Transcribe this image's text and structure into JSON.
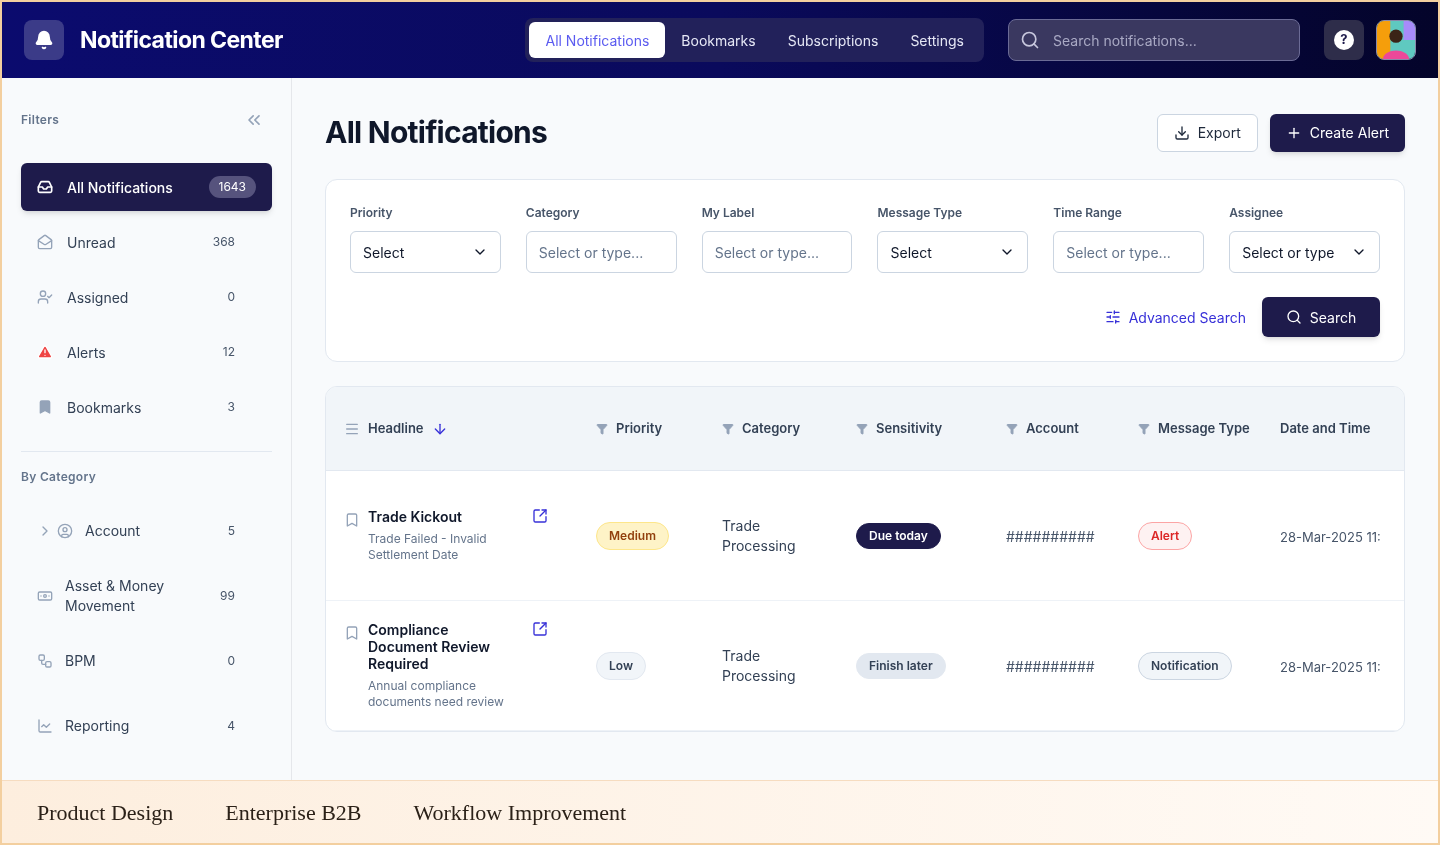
{
  "header": {
    "title": "Notification Center",
    "tabs": [
      {
        "label": "All Notifications",
        "selected": true
      },
      {
        "label": "Bookmarks",
        "selected": false
      },
      {
        "label": "Subscriptions",
        "selected": false
      },
      {
        "label": "Settings",
        "selected": false
      }
    ],
    "search": {
      "placeholder": "Search notifications..."
    },
    "help": "?"
  },
  "sidebar": {
    "title": "Filters",
    "items": [
      {
        "label": "All Notifications",
        "count": "1643",
        "selected": true
      },
      {
        "label": "Unread",
        "count": "368",
        "selected": false
      },
      {
        "label": "Assigned",
        "count": "0",
        "selected": false
      },
      {
        "label": "Alerts",
        "count": "12",
        "selected": false
      },
      {
        "label": "Bookmarks",
        "count": "3",
        "selected": false
      }
    ],
    "category_title": "By Category",
    "categories": [
      {
        "label": "Account",
        "count": "5",
        "expanded": false
      },
      {
        "label": "Asset & Money Movement",
        "count": "99"
      },
      {
        "label": "BPM",
        "count": "0"
      },
      {
        "label": "Reporting",
        "count": "4"
      }
    ]
  },
  "main": {
    "title": "All Notifications",
    "export": "Export",
    "create": "Create Alert",
    "filters": [
      {
        "label": "Priority",
        "kind": "select",
        "value": "Select"
      },
      {
        "label": "Category",
        "kind": "input",
        "placeholder": "Select or type..."
      },
      {
        "label": "My Label",
        "kind": "input",
        "placeholder": "Select or type..."
      },
      {
        "label": "Message Type",
        "kind": "select",
        "value": "Select"
      },
      {
        "label": "Time Range",
        "kind": "input",
        "placeholder": "Select or type..."
      },
      {
        "label": "Assignee",
        "kind": "select",
        "value": "Select or type"
      }
    ],
    "advanced": "Advanced Search",
    "search": "Search",
    "table": {
      "columns": [
        {
          "label": "Headline",
          "kind": "sort"
        },
        {
          "label": "Priority",
          "kind": "filter"
        },
        {
          "label": "Category",
          "kind": "filter"
        },
        {
          "label": "Sensitivity",
          "kind": "filter"
        },
        {
          "label": "Account",
          "kind": "filter"
        },
        {
          "label": "Message Type",
          "kind": "filter"
        },
        {
          "label": "Date and Time",
          "kind": "plain"
        }
      ],
      "rows": [
        {
          "headline": "Trade Kickout",
          "detail": "Trade Failed - Invalid Settlement Date",
          "priority": {
            "label": "Medium",
            "kind": "medium"
          },
          "category": "Trade Processing",
          "sensitivity": {
            "label": "Due today",
            "kind": "due"
          },
          "account": "##########",
          "message_type": {
            "label": "Alert",
            "kind": "alert"
          },
          "date": "28-Mar-2025 11:"
        },
        {
          "headline": "Compliance Document Review Required",
          "detail": "Annual compliance documents need review",
          "priority": {
            "label": "Low",
            "kind": "low"
          },
          "category": "Trade Processing",
          "sensitivity": {
            "label": "Finish later",
            "kind": "later"
          },
          "account": "##########",
          "message_type": {
            "label": "Notification",
            "kind": "notification"
          },
          "date": "28-Mar-2025 11:"
        }
      ]
    }
  },
  "tags": [
    "Product Design",
    "Enterprise B2B",
    "Workflow Improvement"
  ]
}
